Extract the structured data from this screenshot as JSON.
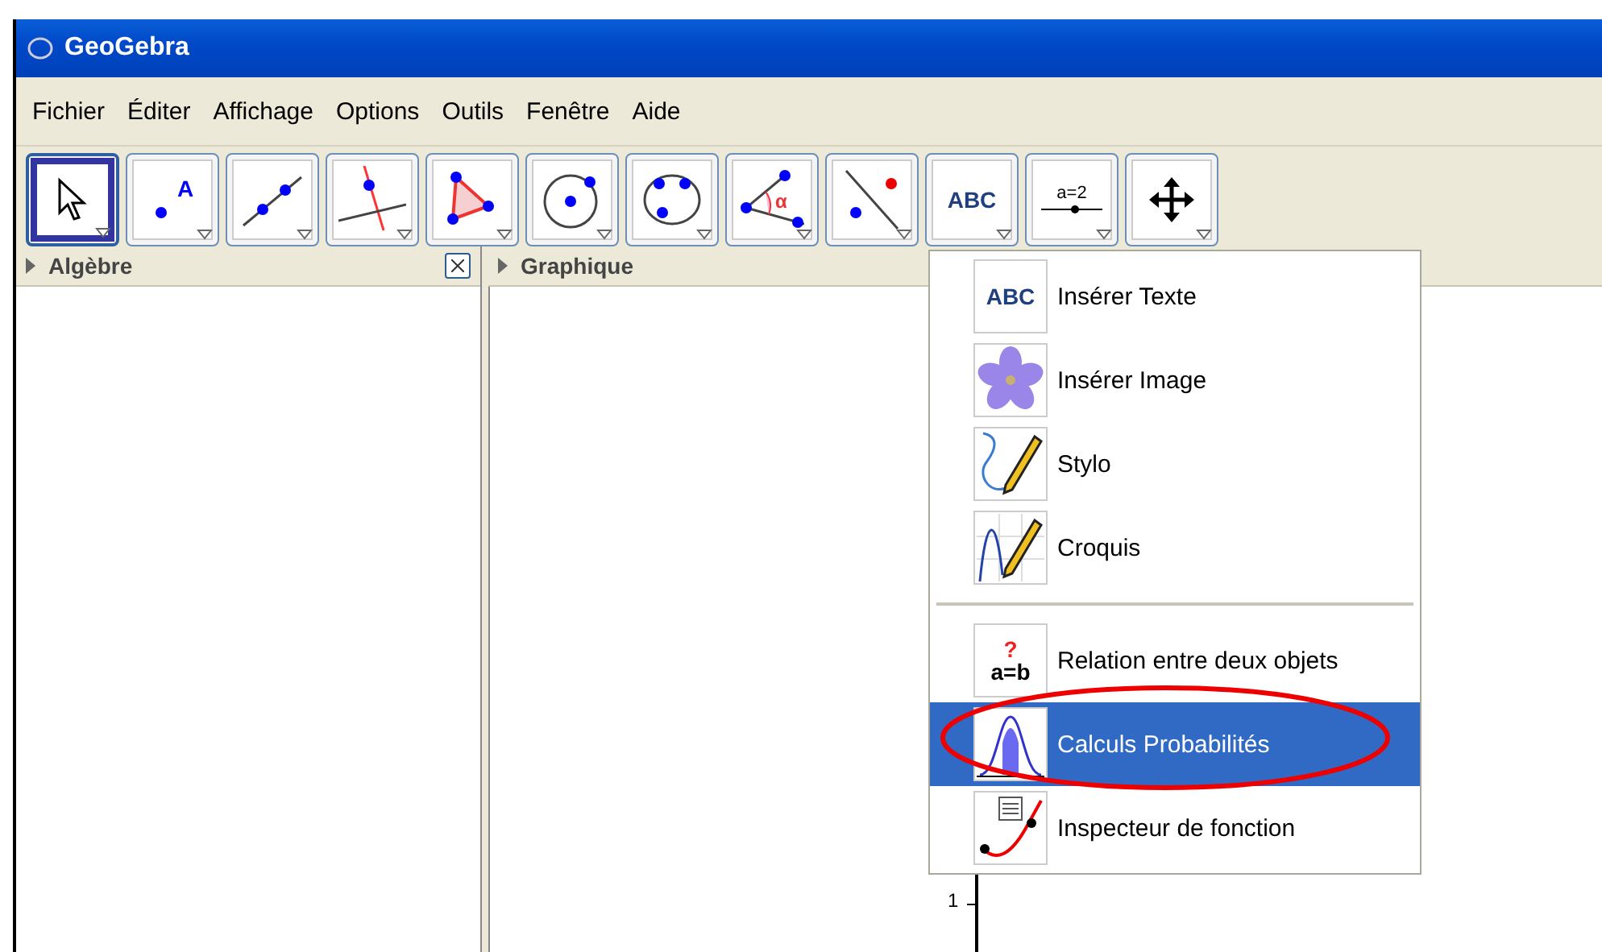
{
  "window": {
    "title": "GeoGebra"
  },
  "menu_bar": [
    "Fichier",
    "Éditer",
    "Affichage",
    "Options",
    "Outils",
    "Fenêtre",
    "Aide"
  ],
  "toolbar": [
    {
      "kind": "move",
      "selected": true
    },
    {
      "kind": "point",
      "selected": false,
      "icon_text": "A"
    },
    {
      "kind": "line",
      "selected": false
    },
    {
      "kind": "perpendicular",
      "selected": false
    },
    {
      "kind": "polygon",
      "selected": false
    },
    {
      "kind": "circle",
      "selected": false
    },
    {
      "kind": "conic",
      "selected": false
    },
    {
      "kind": "angle",
      "selected": false,
      "icon_text": "α"
    },
    {
      "kind": "reflect",
      "selected": false
    },
    {
      "kind": "text",
      "selected": false,
      "icon_text": "ABC"
    },
    {
      "kind": "slider",
      "selected": false,
      "icon_text": "a=2"
    },
    {
      "kind": "move-view",
      "selected": false
    }
  ],
  "panels": [
    {
      "title": "Algèbre",
      "closable": true
    },
    {
      "title": "Graphique",
      "closable": false
    }
  ],
  "dropdown": {
    "groups": [
      [
        {
          "kind": "text",
          "label": "Insérer Texte",
          "icon_text": "ABC",
          "selected": false
        },
        {
          "kind": "image",
          "label": "Insérer Image",
          "selected": false
        },
        {
          "kind": "pen",
          "label": "Stylo",
          "selected": false
        },
        {
          "kind": "sketch",
          "label": "Croquis",
          "selected": false
        }
      ],
      [
        {
          "kind": "relation",
          "label": "Relation entre deux objets",
          "icon_text": "?",
          "icon_text_2": "a=b",
          "selected": false
        },
        {
          "kind": "probability",
          "label": "Calculs Probabilités",
          "selected": true
        },
        {
          "kind": "inspector",
          "label": "Inspecteur de fonction",
          "selected": false
        }
      ]
    ]
  },
  "graphics": {
    "y_tick": "1"
  }
}
